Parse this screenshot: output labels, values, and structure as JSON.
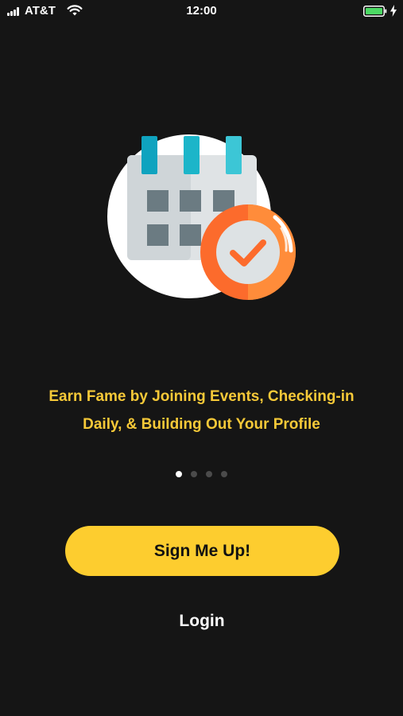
{
  "status_bar": {
    "carrier": "AT&T",
    "time": "12:00",
    "battery_color": "#4cd964"
  },
  "illustration": {
    "icon": "calendar-check-icon",
    "circle_color": "#ffffff",
    "badge_color": "#fc6b2c",
    "check_color": "#fc6b2c"
  },
  "onboarding": {
    "headline_line1": "Earn Fame by Joining Events, Checking-in",
    "headline_line2": "Daily, & Building Out Your Profile",
    "page_count": 4,
    "active_page": 1,
    "accent_color": "#f6c938"
  },
  "actions": {
    "signup_label": "Sign Me Up!",
    "login_label": "Login",
    "signup_color": "#fdcd2f"
  }
}
